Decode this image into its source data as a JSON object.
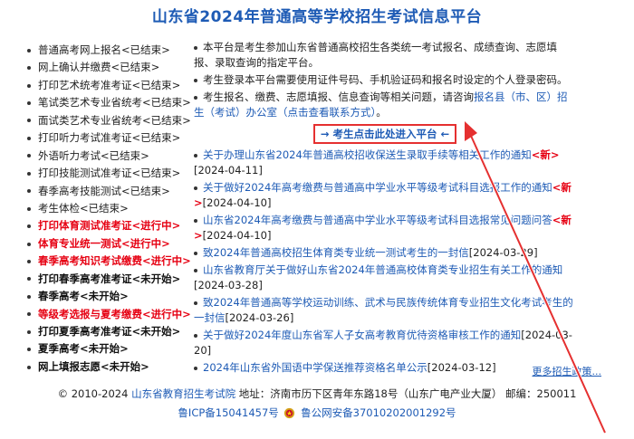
{
  "title": "山东省2024年普通高等学校招生考试信息平台",
  "sidebar": {
    "items": [
      {
        "label": "普通高考网上报名<已结束>",
        "status": "ended"
      },
      {
        "label": "网上确认并缴费<已结束>",
        "status": "ended"
      },
      {
        "label": "打印艺术统考准考证<已结束>",
        "status": "ended"
      },
      {
        "label": "笔试类艺术专业省统考<已结束>",
        "status": "ended"
      },
      {
        "label": "面试类艺术专业省统考<已结束>",
        "status": "ended"
      },
      {
        "label": "打印听力考试准考证<已结束>",
        "status": "ended"
      },
      {
        "label": "外语听力考试<已结束>",
        "status": "ended"
      },
      {
        "label": "打印技能测试准考证<已结束>",
        "status": "ended"
      },
      {
        "label": "春季高考技能测试<已结束>",
        "status": "ended"
      },
      {
        "label": "考生体检<已结束>",
        "status": "ended"
      },
      {
        "label": "打印体育测试准考证<进行中>",
        "status": "active"
      },
      {
        "label": "体育专业统一测试<进行中>",
        "status": "active"
      },
      {
        "label": "春季高考知识考试缴费<进行中>",
        "status": "active"
      },
      {
        "label": "打印春季高考准考证<未开始>",
        "status": "pending"
      },
      {
        "label": "春季高考<未开始>",
        "status": "pending"
      },
      {
        "label": "等级考选报与夏考缴费<进行中>",
        "status": "active"
      },
      {
        "label": "打印夏季高考准考证<未开始>",
        "status": "pending"
      },
      {
        "label": "夏季高考<未开始>",
        "status": "pending"
      },
      {
        "label": "网上填报志愿<未开始>",
        "status": "pending"
      }
    ]
  },
  "info": {
    "p1": "本平台是考生参加山东省普通高校招生各类统一考试报名、成绩查询、志愿填报、录取查询的指定平台。",
    "p2": "考生登录本平台需要使用证件号码、手机验证码和报名时设定的个人登录密码。",
    "p3_prefix": "考生报名、缴费、志愿填报、信息查询等相关问题，请咨询",
    "p3_link": "报名县（市、区）招生（考试）办公室（点击查看联系方式）",
    "p3_suffix": "。"
  },
  "entry_button": "→ 考生点击此处进入平台 ←",
  "news": [
    {
      "title": "关于办理山东省2024年普通高校招收保送生录取手续等相关工作的通知",
      "new": "<新>",
      "date": "[2024-04-11]"
    },
    {
      "title": "关于做好2024年高考缴费与普通高中学业水平等级考试科目选报工作的通知",
      "new": "<新>",
      "date": "[2024-04-10]"
    },
    {
      "title": "山东省2024年高考缴费与普通高中学业水平等级考试科目选报常见问题问答",
      "new": "<新>",
      "date": "[2024-04-10]"
    },
    {
      "title": "致2024年普通高校招生体育类专业统一测试考生的一封信",
      "new": "",
      "date": "[2024-03-29]"
    },
    {
      "title": "山东省教育厅关于做好山东省2024年普通高校体育类专业招生有关工作的通知",
      "new": "",
      "date": "[2024-03-28]"
    },
    {
      "title": "致2024年普通高等学校运动训练、武术与民族传统体育专业招生文化考试考生的一封信",
      "new": "",
      "date": "[2024-03-26]"
    },
    {
      "title": "关于做好2024年度山东省军人子女高考教育优待资格审核工作的通知",
      "new": "",
      "date": "[2024-03-20]"
    },
    {
      "title": "2024年山东省外国语中学保送推荐资格名单公示",
      "new": "",
      "date": "[2024-03-12]"
    }
  ],
  "more_link": "更多招生政策...",
  "footer": {
    "copyright": "© 2010-2024",
    "org_link": "山东省教育招生考试院",
    "address": "地址：济南市历下区青年东路18号（山东广电产业大厦） 邮编：250011",
    "icp": "鲁ICP备15041457号",
    "police": "鲁公网安备37010202001292号"
  },
  "colors": {
    "accent": "#1e5bb5",
    "active": "#e60012",
    "highlight": "#e53030"
  }
}
